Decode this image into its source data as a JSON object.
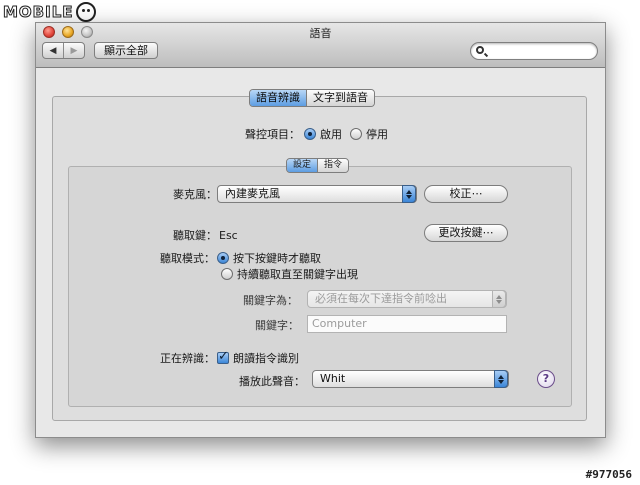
{
  "watermark": {
    "logo_text": "MOBILE",
    "id": "#977056"
  },
  "window": {
    "title": "語音",
    "nav": {
      "back": "◀",
      "forward": "▶"
    },
    "show_all": "顯示全部",
    "search": {
      "value": "",
      "placeholder": ""
    }
  },
  "tabs": [
    "語音辨識",
    "文字到語音"
  ],
  "voice_control": {
    "label": "聲控項目：",
    "options": [
      "啟用",
      "停用"
    ],
    "selected": "啟用"
  },
  "subtabs": [
    "設定",
    "指令"
  ],
  "microphone": {
    "label": "麥克風：",
    "value": "內建麥克風",
    "calibrate_button": "校正⋯"
  },
  "listening_key": {
    "label": "聽取鍵：",
    "value": "Esc",
    "change_button": "更改按鍵⋯"
  },
  "listening_mode": {
    "label": "聽取模式：",
    "options": [
      "按下按鍵時才聽取",
      "持續聽取直至關鍵字出現"
    ],
    "selected": "按下按鍵時才聽取"
  },
  "keyword_is": {
    "label": "關鍵字為：",
    "value": "必須在每次下達指令前唸出"
  },
  "keyword": {
    "label": "關鍵字：",
    "value": "Computer"
  },
  "upon_recognition": {
    "label": "正在辨識：",
    "speak_command_label": "朗讀指令識別",
    "speak_command_checked": true,
    "play_sound_label": "播放此聲音：",
    "play_sound_value": "Whit"
  },
  "help": "?",
  "colors": {
    "accent": "#5d9de2",
    "window_bg": "#e8e8e8",
    "help_purple": "#5a3a85"
  }
}
